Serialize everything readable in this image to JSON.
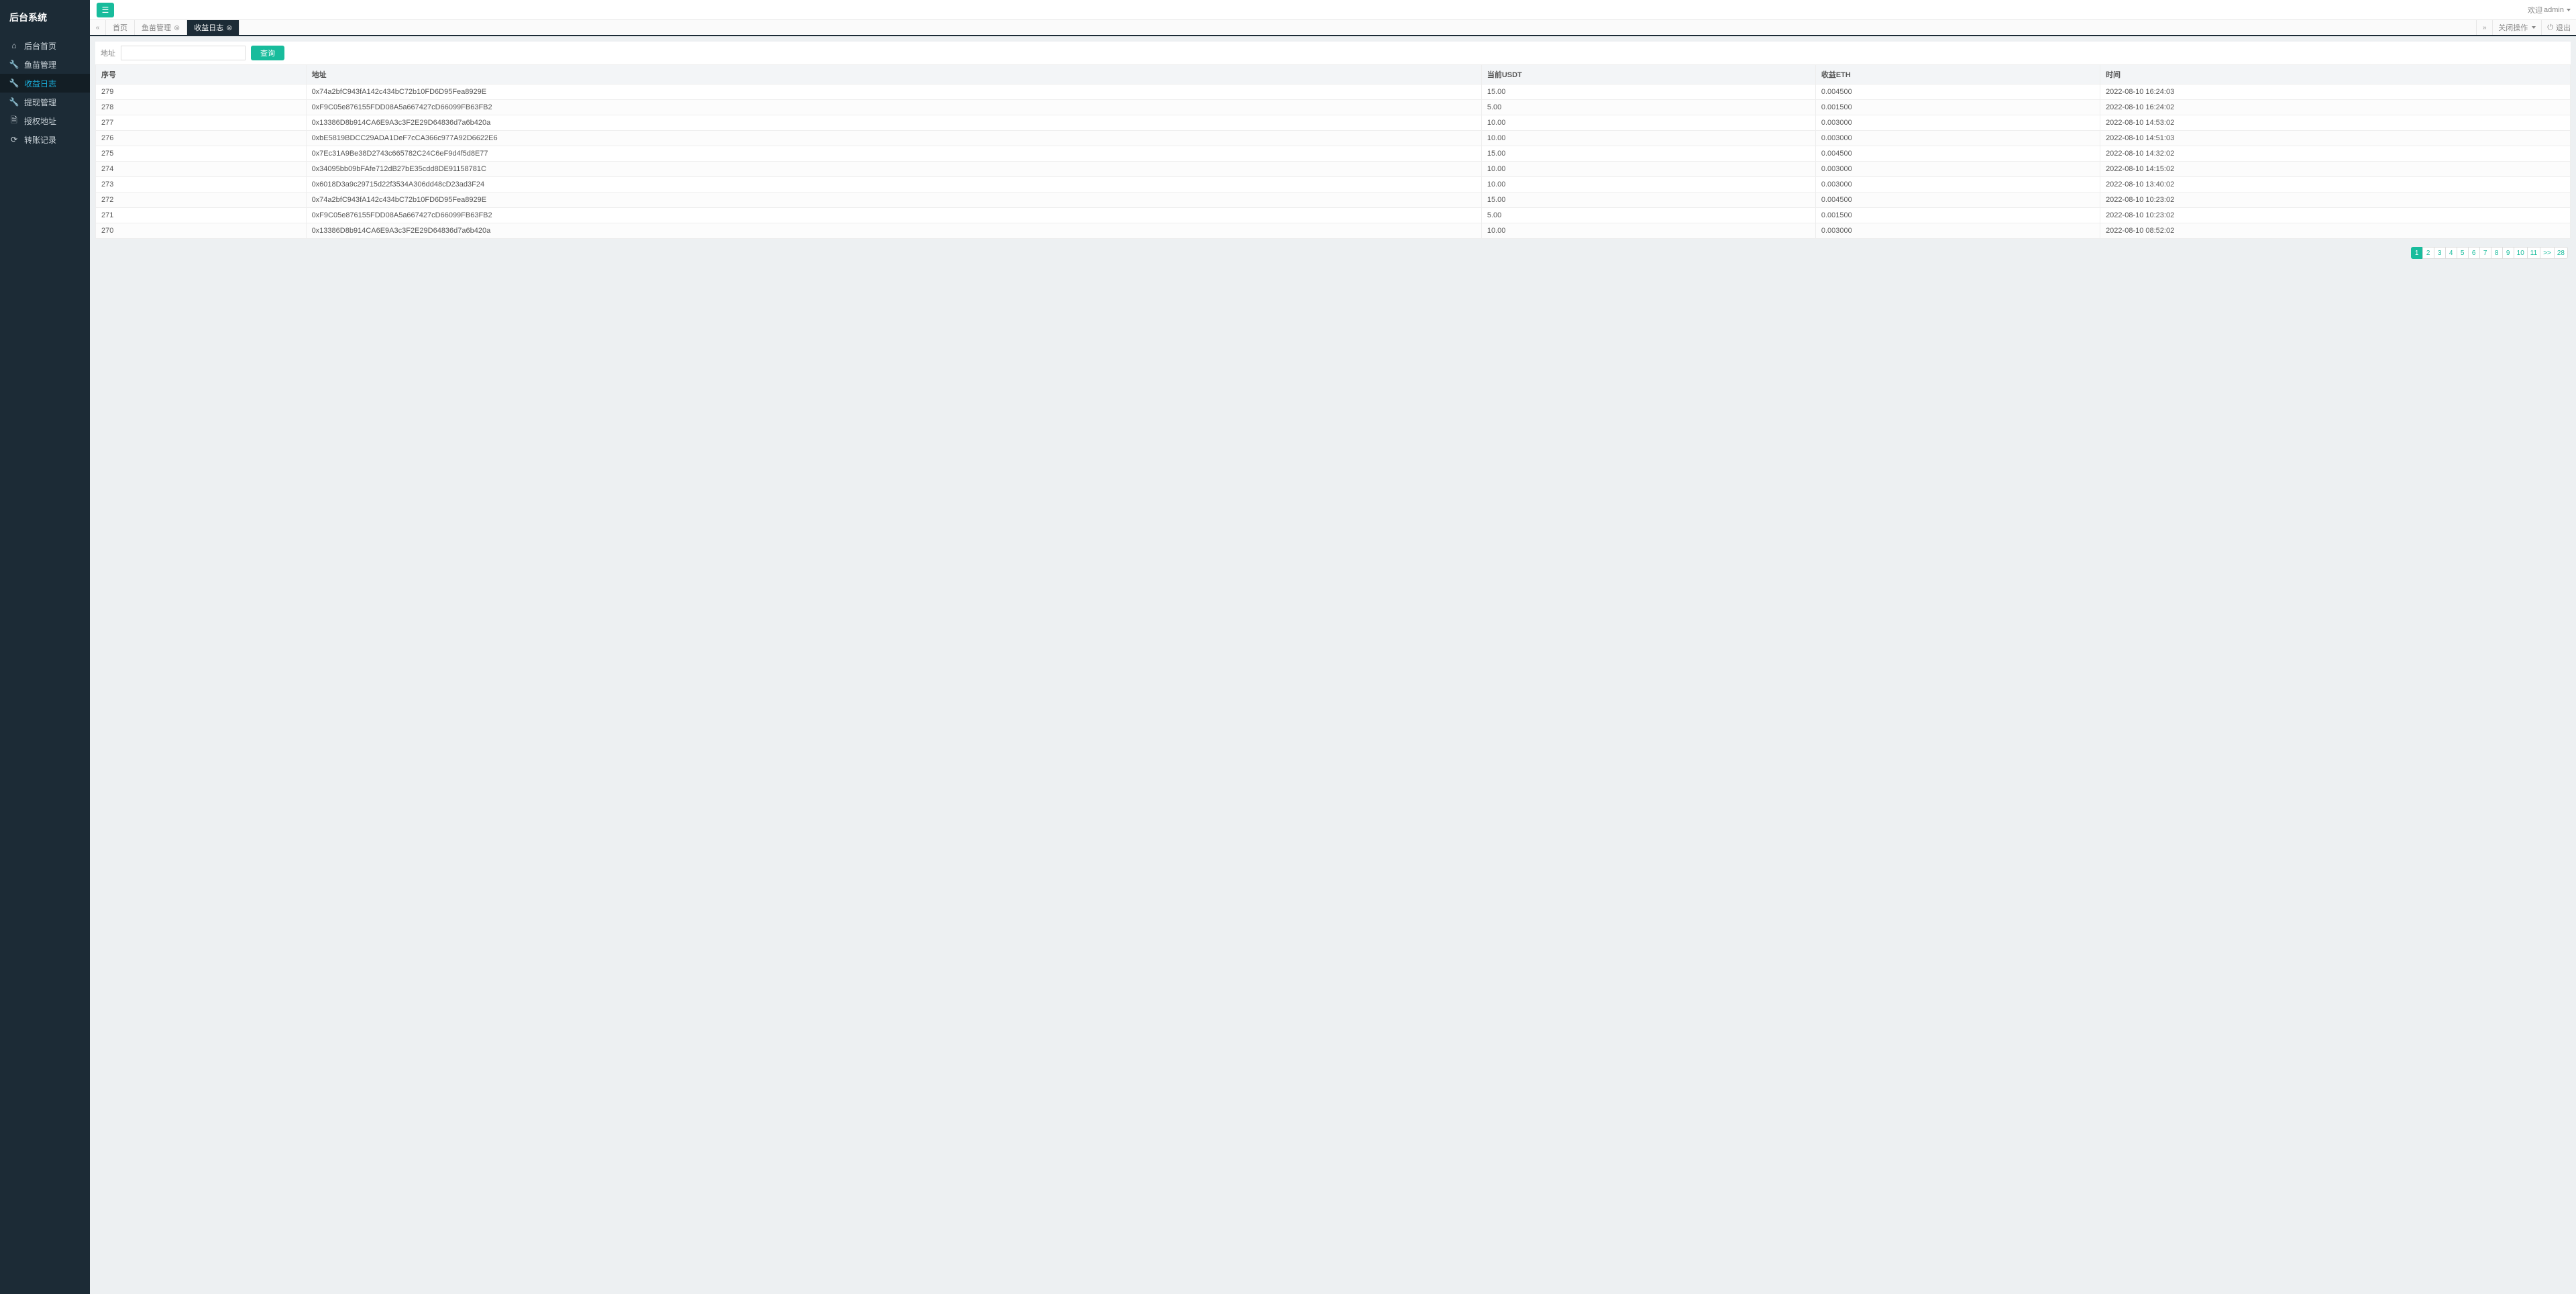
{
  "brand": "后台系统",
  "sidebar": {
    "items": [
      {
        "icon": "home-icon",
        "glyph": "⌂",
        "label": "后台首页"
      },
      {
        "icon": "wrench-icon",
        "glyph": "🔧",
        "label": "鱼苗管理"
      },
      {
        "icon": "wrench-icon",
        "glyph": "🔧",
        "label": "收益日志",
        "active": true
      },
      {
        "icon": "wrench-icon",
        "glyph": "🔧",
        "label": "提现管理"
      },
      {
        "icon": "file-icon",
        "glyph": "🗎",
        "label": "授权地址"
      },
      {
        "icon": "refresh-icon",
        "glyph": "⟳",
        "label": "转账记录"
      }
    ]
  },
  "topbar": {
    "welcome_prefix": "欢迎 ",
    "welcome_user": "admin"
  },
  "tabstrip": {
    "tabs": [
      {
        "label": "首页",
        "closable": false
      },
      {
        "label": "鱼苗管理",
        "closable": true
      },
      {
        "label": "收益日志",
        "closable": true,
        "active": true
      }
    ],
    "close_ops_label": "关闭操作",
    "logout_label": "退出"
  },
  "search": {
    "label": "地址",
    "value": "",
    "button": "查询"
  },
  "table": {
    "columns": [
      "序号",
      "地址",
      "当前USDT",
      "收益ETH",
      "时间"
    ],
    "rows": [
      {
        "no": "279",
        "addr": "0x74a2bfC943fA142c434bC72b10FD6D95Fea8929E",
        "usdt": "15.00",
        "eth": "0.004500",
        "time": "2022-08-10 16:24:03"
      },
      {
        "no": "278",
        "addr": "0xF9C05e876155FDD08A5a667427cD66099FB63FB2",
        "usdt": "5.00",
        "eth": "0.001500",
        "time": "2022-08-10 16:24:02"
      },
      {
        "no": "277",
        "addr": "0x13386D8b914CA6E9A3c3F2E29D64836d7a6b420a",
        "usdt": "10.00",
        "eth": "0.003000",
        "time": "2022-08-10 14:53:02"
      },
      {
        "no": "276",
        "addr": "0xbE5819BDCC29ADA1DeF7cCA366c977A92D6622E6",
        "usdt": "10.00",
        "eth": "0.003000",
        "time": "2022-08-10 14:51:03"
      },
      {
        "no": "275",
        "addr": "0x7Ec31A9Be38D2743c665782C24C6eF9d4f5d8E77",
        "usdt": "15.00",
        "eth": "0.004500",
        "time": "2022-08-10 14:32:02"
      },
      {
        "no": "274",
        "addr": "0x34095bb09bFAfe712dB27bE35cdd8DE91158781C",
        "usdt": "10.00",
        "eth": "0.003000",
        "time": "2022-08-10 14:15:02"
      },
      {
        "no": "273",
        "addr": "0x6018D3a9c29715d22f3534A306dd48cD23ad3F24",
        "usdt": "10.00",
        "eth": "0.003000",
        "time": "2022-08-10 13:40:02"
      },
      {
        "no": "272",
        "addr": "0x74a2bfC943fA142c434bC72b10FD6D95Fea8929E",
        "usdt": "15.00",
        "eth": "0.004500",
        "time": "2022-08-10 10:23:02"
      },
      {
        "no": "271",
        "addr": "0xF9C05e876155FDD08A5a667427cD66099FB63FB2",
        "usdt": "5.00",
        "eth": "0.001500",
        "time": "2022-08-10 10:23:02"
      },
      {
        "no": "270",
        "addr": "0x13386D8b914CA6E9A3c3F2E29D64836d7a6b420a",
        "usdt": "10.00",
        "eth": "0.003000",
        "time": "2022-08-10 08:52:02"
      }
    ]
  },
  "pagination": {
    "pages": [
      "1",
      "2",
      "3",
      "4",
      "5",
      "6",
      "7",
      "8",
      "9",
      "10",
      "11",
      ">>",
      "28"
    ],
    "active": "1"
  }
}
